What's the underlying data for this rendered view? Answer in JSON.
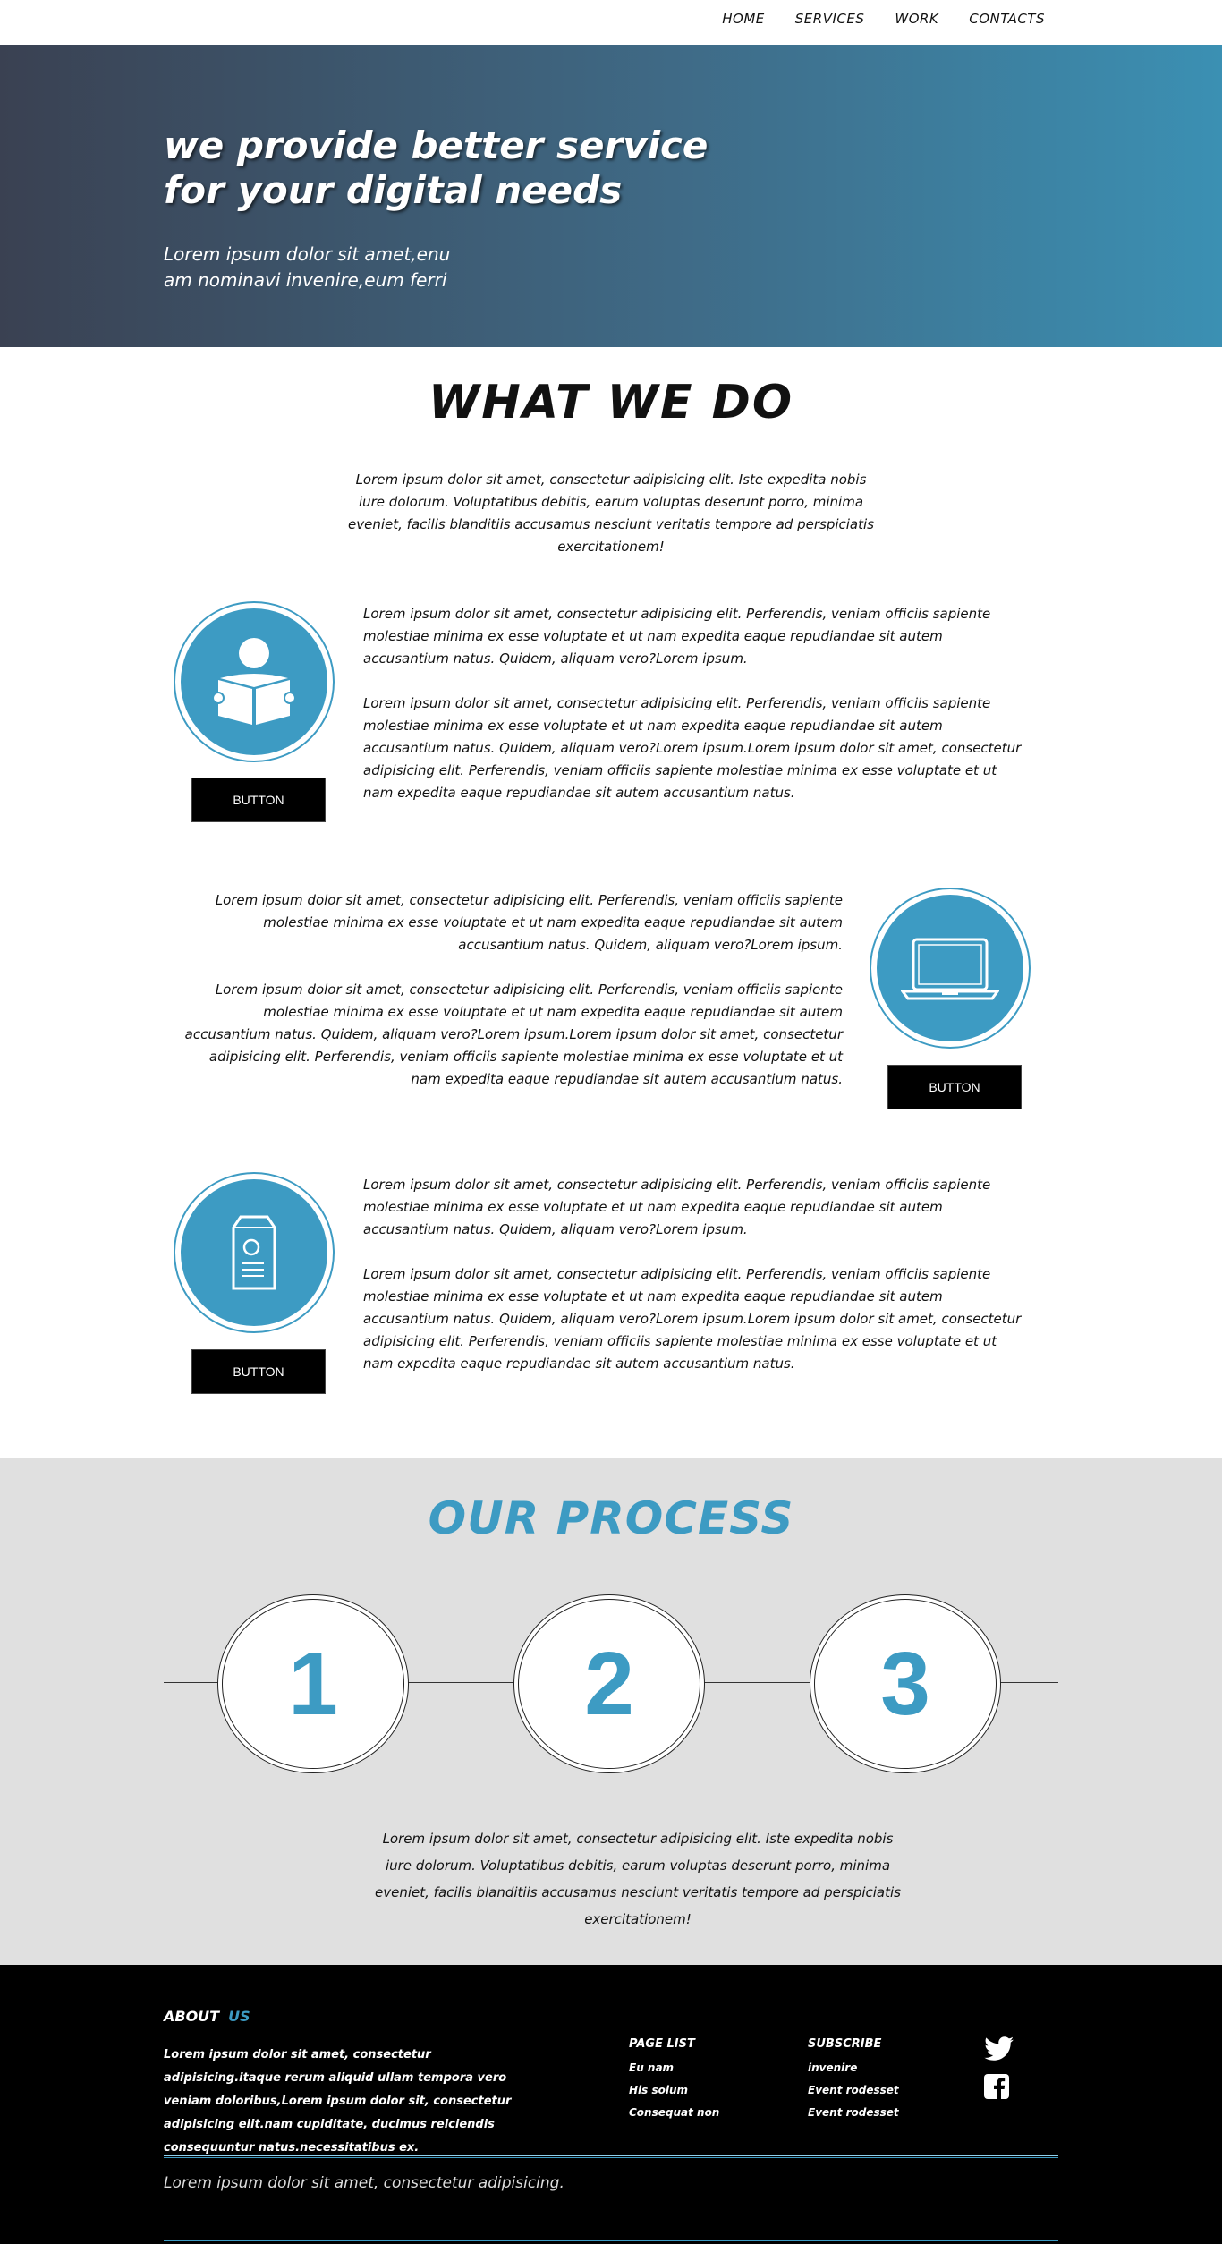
{
  "nav": {
    "items": [
      {
        "label": "HOME"
      },
      {
        "label": "SERVICES"
      },
      {
        "label": "WORK"
      },
      {
        "label": "CONTACTS"
      }
    ]
  },
  "hero": {
    "title_line1": "we provide better service",
    "title_line2": "for your digital needs",
    "subtitle_line1": "Lorem ipsum dolor sit amet,enu",
    "subtitle_line2": "am nominavi invenire,eum ferri"
  },
  "what_we_do": {
    "title": "WHAT WE DO",
    "intro": "Lorem ipsum dolor sit amet, consectetur adipisicing elit. Iste expedita nobis iure dolorum. Voluptatibus debitis, earum voluptas deserunt porro, minima eveniet, facilis blanditiis accusamus nesciunt veritatis tempore ad perspiciatis exercitationem!",
    "features": [
      {
        "icon": "reader-icon",
        "button": "BUTTON",
        "para1": "Lorem ipsum dolor sit amet, consectetur adipisicing elit. Perferendis, veniam officiis sapiente molestiae minima ex esse voluptate et ut nam expedita eaque repudiandae sit autem accusantium natus. Quidem, aliquam vero?Lorem ipsum.",
        "para2": "Lorem ipsum dolor sit amet, consectetur adipisicing elit. Perferendis, veniam officiis sapiente molestiae minima ex esse voluptate et ut nam expedita eaque repudiandae sit autem accusantium natus. Quidem, aliquam vero?Lorem ipsum.Lorem ipsum dolor sit amet, consectetur adipisicing elit. Perferendis, veniam officiis sapiente molestiae minima ex esse voluptate et ut nam expedita eaque repudiandae sit autem accusantium natus."
      },
      {
        "icon": "laptop-icon",
        "button": "BUTTON",
        "para1": "Lorem ipsum dolor sit amet, consectetur adipisicing elit. Perferendis, veniam officiis sapiente molestiae minima ex esse voluptate et ut nam expedita eaque repudiandae sit autem accusantium natus. Quidem, aliquam vero?Lorem ipsum.",
        "para2": "Lorem ipsum dolor sit amet, consectetur adipisicing elit. Perferendis, veniam officiis sapiente molestiae minima ex esse voluptate et ut nam expedita eaque repudiandae sit autem accusantium natus. Quidem, aliquam vero?Lorem ipsum.Lorem ipsum dolor sit amet, consectetur adipisicing elit. Perferendis, veniam officiis sapiente molestiae minima ex esse voluptate et ut nam expedita eaque repudiandae sit autem accusantium natus."
      },
      {
        "icon": "package-icon",
        "button": "BUTTON",
        "para1": "Lorem ipsum dolor sit amet, consectetur adipisicing elit. Perferendis, veniam officiis sapiente molestiae minima ex esse voluptate et ut nam expedita eaque repudiandae sit autem accusantium natus. Quidem, aliquam vero?Lorem ipsum.",
        "para2": "Lorem ipsum dolor sit amet, consectetur adipisicing elit. Perferendis, veniam officiis sapiente molestiae minima ex esse voluptate et ut nam expedita eaque repudiandae sit autem accusantium natus. Quidem, aliquam vero?Lorem ipsum.Lorem ipsum dolor sit amet, consectetur adipisicing elit. Perferendis, veniam officiis sapiente molestiae minima ex esse voluptate et ut nam expedita eaque repudiandae sit autem accusantium natus."
      }
    ]
  },
  "process": {
    "title": "OUR PROCESS",
    "steps": [
      "1",
      "2",
      "3"
    ],
    "description": "Lorem ipsum dolor sit amet, consectetur adipisicing elit. Iste expedita nobis iure dolorum. Voluptatibus debitis, earum voluptas deserunt porro, minima eveniet, facilis blanditiis accusamus nesciunt veritatis tempore ad perspiciatis exercitationem!"
  },
  "footer": {
    "about_label": "ABOUT",
    "about_us": "US",
    "about_text": "Lorem ipsum dolor sit amet, consectetur adipisicing.itaque rerum aliquid ullam tempora vero veniam doloribus,Lorem ipsum dolor sit, consectetur adipisicing elit.nam cupiditate, ducimus reiciendis consequuntur natus.necessitatibus ex.",
    "page_list": {
      "heading": "PAGE LIST",
      "items": [
        "Eu nam",
        "His solum",
        "Consequat non"
      ]
    },
    "subscribe": {
      "heading": "SUBSCRIBE",
      "items": [
        "invenire",
        "Event rodesset",
        "Event rodesset"
      ]
    },
    "social_icons": [
      "twitter-icon",
      "facebook-icon"
    ],
    "copyright": "Lorem ipsum dolor sit amet, consectetur adipisicing.",
    "accent_color": "#3d9bc3"
  }
}
